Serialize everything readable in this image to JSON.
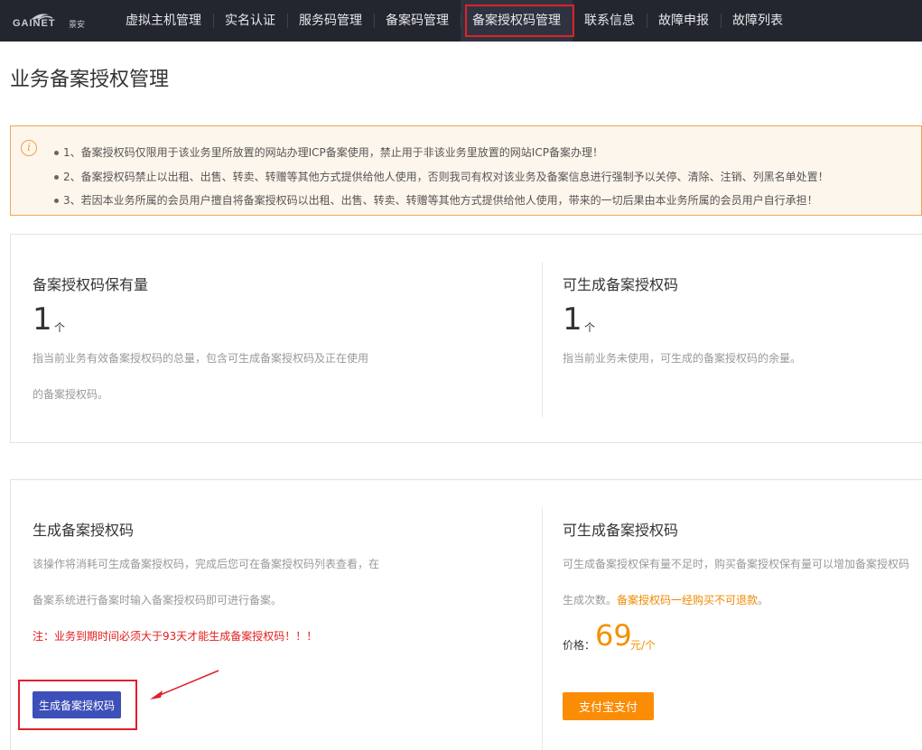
{
  "nav": {
    "logo_text": "GAINET",
    "logo_sub": "景安",
    "items": [
      {
        "label": "虚拟主机管理"
      },
      {
        "label": "实名认证"
      },
      {
        "label": "服务码管理"
      },
      {
        "label": "备案码管理"
      },
      {
        "label": "备案授权码管理"
      },
      {
        "label": "联系信息"
      },
      {
        "label": "故障申报"
      },
      {
        "label": "故障列表"
      }
    ],
    "active_index": 4
  },
  "page_title": "业务备案授权管理",
  "notice": {
    "icon": "info-icon",
    "items": [
      "1、备案授权码仅限用于该业务里所放置的网站办理ICP备案使用，禁止用于非该业务里放置的网站ICP备案办理！",
      "2、备案授权码禁止以出租、出售、转卖、转赠等其他方式提供给他人使用，否则我司有权对该业务及备案信息进行强制予以关停、清除、注销、列黑名单处置！",
      "3、若因本业务所属的会员用户擅自将备案授权码以出租、出售、转卖、转赠等其他方式提供给他人使用，带来的一切后果由本业务所属的会员用户自行承担！"
    ]
  },
  "stats": {
    "held": {
      "title": "备案授权码保有量",
      "value": "1",
      "unit": "个",
      "desc_line1": "指当前业务有效备案授权码的总量，包含可生成备案授权码及正在使用",
      "desc_line2": "的备案授权码。"
    },
    "available": {
      "title": "可生成备案授权码",
      "value": "1",
      "unit": "个",
      "desc": "指当前业务未使用，可生成的备案授权码的余量。"
    }
  },
  "generate": {
    "title": "生成备案授权码",
    "desc_line1": "该操作将消耗可生成备案授权码，完成后您可在备案授权码列表查看，在",
    "desc_line2": "备案系统进行备案时输入备案授权码即可进行备案。",
    "warning": "注：业务到期时间必须大于93天才能生成备案授权码！！！",
    "button": "生成备案授权码"
  },
  "purchase": {
    "title": "可生成备案授权码",
    "desc_line1": "可生成备案授权保有量不足时，购买备案授权保有量可以增加备案授权码",
    "desc_line2_prefix": "生成次数。",
    "desc_line2_orange": "备案授权码一经购买不可退款",
    "desc_line2_suffix": "。",
    "price_label": "价格：",
    "price_value": "69",
    "price_unit": "元/个",
    "button": "支付宝支付"
  },
  "colors": {
    "nav_bg": "#23262e",
    "highlight": "#e0202a",
    "primary_button": "#3d4fb8",
    "pay_button": "#fb8c05",
    "price": "#f29100",
    "notice_bg": "#fdf6ec",
    "notice_border": "#f0a65a"
  }
}
